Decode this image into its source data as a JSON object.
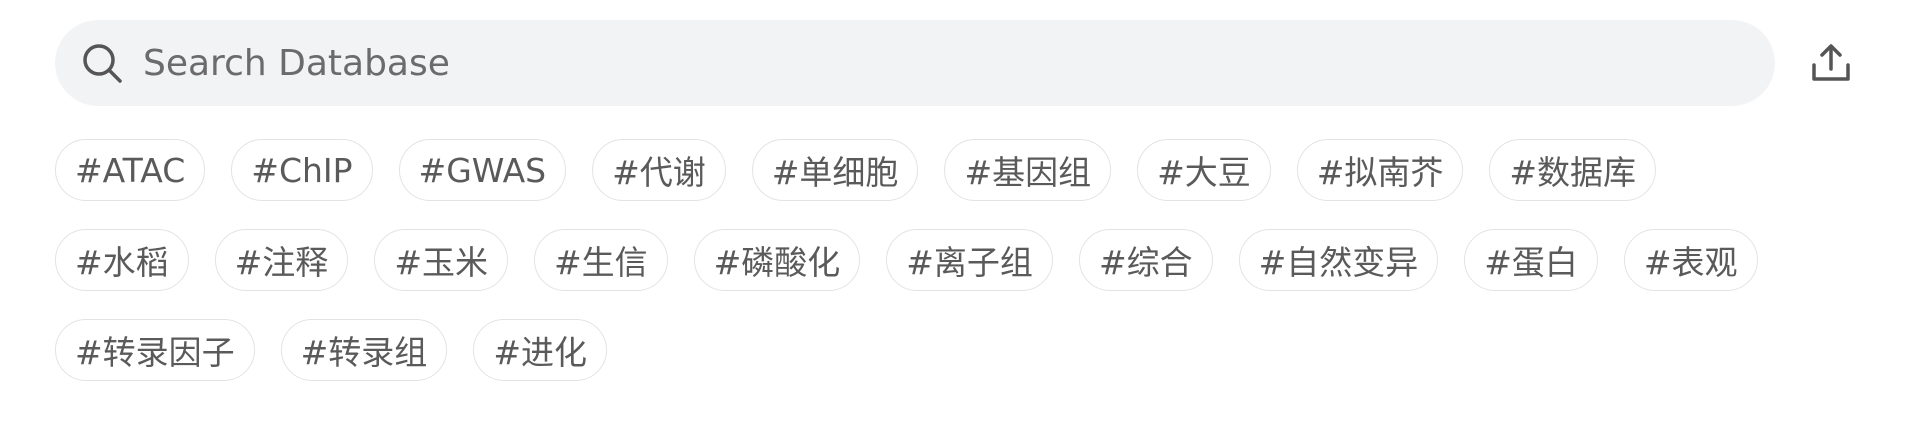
{
  "search": {
    "placeholder": "Search Database",
    "icon": "search-icon"
  },
  "upload": {
    "icon": "upload-icon"
  },
  "tags": [
    "#ATAC",
    "#ChIP",
    "#GWAS",
    "#代谢",
    "#单细胞",
    "#基因组",
    "#大豆",
    "#拟南芥",
    "#数据库",
    "#水稻",
    "#注释",
    "#玉米",
    "#生信",
    "#磷酸化",
    "#离子组",
    "#综合",
    "#自然变异",
    "#蛋白",
    "#表观",
    "#转录因子",
    "#转录组",
    "#进化"
  ],
  "colors": {
    "search_bg": "#f2f3f5",
    "tag_border": "#e3e3e3",
    "tag_text": "#5a5a5a",
    "icon": "#555555"
  }
}
